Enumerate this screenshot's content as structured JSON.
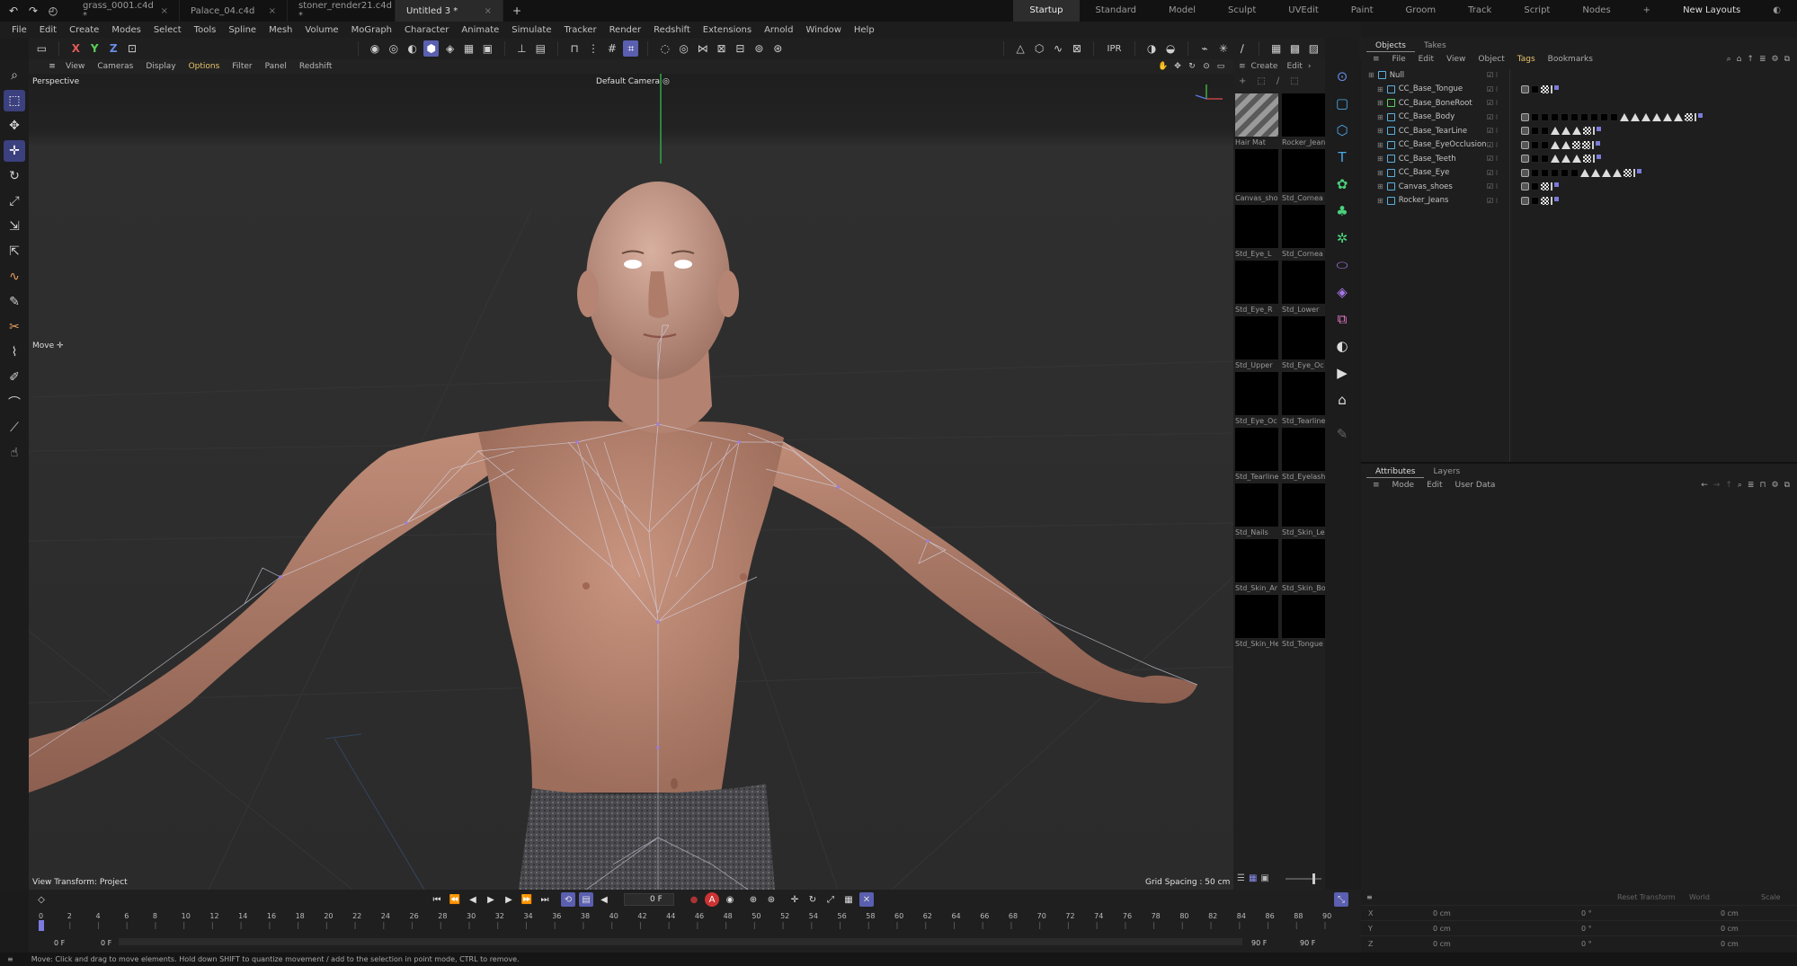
{
  "tabs": [
    {
      "label": "grass_0001.c4d *",
      "active": false
    },
    {
      "label": "Palace_04.c4d",
      "active": false
    },
    {
      "label": "stoner_render21.c4d *",
      "active": false
    },
    {
      "label": "Untitled 3 *",
      "active": true
    }
  ],
  "layouts": [
    "Startup",
    "Standard",
    "Model",
    "Sculpt",
    "UVEdit",
    "Paint",
    "Groom",
    "Track",
    "Script",
    "Nodes"
  ],
  "active_layout": "Startup",
  "new_layouts": "New Layouts",
  "menu": [
    "File",
    "Edit",
    "Create",
    "Modes",
    "Select",
    "Tools",
    "Spline",
    "Mesh",
    "Volume",
    "MoGraph",
    "Character",
    "Animate",
    "Simulate",
    "Tracker",
    "Render",
    "Redshift",
    "Extensions",
    "Arnold",
    "Window",
    "Help"
  ],
  "toolbar": {
    "x": "X",
    "y": "Y",
    "z": "Z",
    "ipr": "IPR"
  },
  "viewport": {
    "menu": [
      "View",
      "Cameras",
      "Display",
      "Options",
      "Filter",
      "Panel",
      "Redshift"
    ],
    "projection": "Perspective",
    "camera": "Default Camera",
    "tool": "Move",
    "view_transform": "View Transform: Project",
    "grid_spacing": "Grid Spacing : 50 cm"
  },
  "materials": {
    "menu": [
      "Create",
      "Edit"
    ],
    "items": [
      "Hair Mat",
      "Rocker_Jean",
      "Canvas_sho",
      "Std_Cornea",
      "Std_Eye_L",
      "Std_Cornea",
      "Std_Eye_R",
      "Std_Lower",
      "Std_Upper",
      "Std_Eye_Oc",
      "Std_Eye_Oc",
      "Std_Tearline",
      "Std_Tearline",
      "Std_Eyelash",
      "Std_Nails",
      "Std_Skin_Le",
      "Std_Skin_Ar",
      "Std_Skin_Bo",
      "Std_Skin_He",
      "Std_Tongue"
    ]
  },
  "objects_panel": {
    "tabs": [
      "Objects",
      "Takes"
    ],
    "menu": [
      "File",
      "Edit",
      "View",
      "Object",
      "Tags",
      "Bookmarks"
    ],
    "rows": [
      {
        "name": "Null",
        "tags": []
      },
      {
        "name": "CC_Base_Tongue",
        "tags": [
          "lock",
          "blk",
          "chk",
          "flg"
        ]
      },
      {
        "name": "CC_Base_BoneRoot",
        "tags": []
      },
      {
        "name": "CC_Base_Body",
        "tags": [
          "lock",
          "blk",
          "blk",
          "blk",
          "blk",
          "blk",
          "blk",
          "blk",
          "blk",
          "blk",
          "tri",
          "tri",
          "tri",
          "tri",
          "tri",
          "tri",
          "chk",
          "flg"
        ]
      },
      {
        "name": "CC_Base_TearLine",
        "tags": [
          "lock",
          "blk",
          "blk",
          "tri",
          "tri",
          "tri",
          "chk",
          "flg"
        ]
      },
      {
        "name": "CC_Base_EyeOcclusion",
        "tags": [
          "lock",
          "blk",
          "blk",
          "tri",
          "tri",
          "chk",
          "chk",
          "flg"
        ]
      },
      {
        "name": "CC_Base_Teeth",
        "tags": [
          "lock",
          "blk",
          "blk",
          "tri",
          "tri",
          "tri",
          "chk",
          "flg"
        ]
      },
      {
        "name": "CC_Base_Eye",
        "tags": [
          "lock",
          "blk",
          "blk",
          "blk",
          "blk",
          "blk",
          "tri",
          "tri",
          "tri",
          "tri",
          "chk",
          "flg"
        ]
      },
      {
        "name": "Canvas_shoes",
        "tags": [
          "lock",
          "blk",
          "chk",
          "flg"
        ]
      },
      {
        "name": "Rocker_Jeans",
        "tags": [
          "lock",
          "blk",
          "chk",
          "flg"
        ]
      }
    ]
  },
  "attributes_panel": {
    "tabs": [
      "Attributes",
      "Layers"
    ],
    "menu": [
      "Mode",
      "Edit",
      "User Data"
    ]
  },
  "coords": {
    "buttons": [
      "Reset Transform",
      "World",
      "Scale"
    ],
    "rows": [
      {
        "axis": "X",
        "pos": "0 cm",
        "rot": "0 °",
        "size": "0 cm"
      },
      {
        "axis": "Y",
        "pos": "0 cm",
        "rot": "0 °",
        "size": "0 cm"
      },
      {
        "axis": "Z",
        "pos": "0 cm",
        "rot": "0 °",
        "size": "0 cm"
      }
    ]
  },
  "timeline": {
    "current_frame": "0 F",
    "start": "0 F",
    "start2": "0 F",
    "end": "90 F",
    "end2": "90 F",
    "ticks": [
      "0",
      "2",
      "4",
      "6",
      "8",
      "10",
      "12",
      "14",
      "16",
      "18",
      "20",
      "22",
      "24",
      "26",
      "28",
      "30",
      "32",
      "34",
      "36",
      "38",
      "40",
      "42",
      "44",
      "46",
      "48",
      "50",
      "52",
      "54",
      "56",
      "58",
      "60",
      "62",
      "64",
      "66",
      "68",
      "70",
      "72",
      "74",
      "76",
      "78",
      "80",
      "82",
      "84",
      "86",
      "88",
      "90"
    ]
  },
  "status": "Move: Click and drag to move elements. Hold down SHIFT to quantize movement / add to the selection in point mode, CTRL to remove."
}
